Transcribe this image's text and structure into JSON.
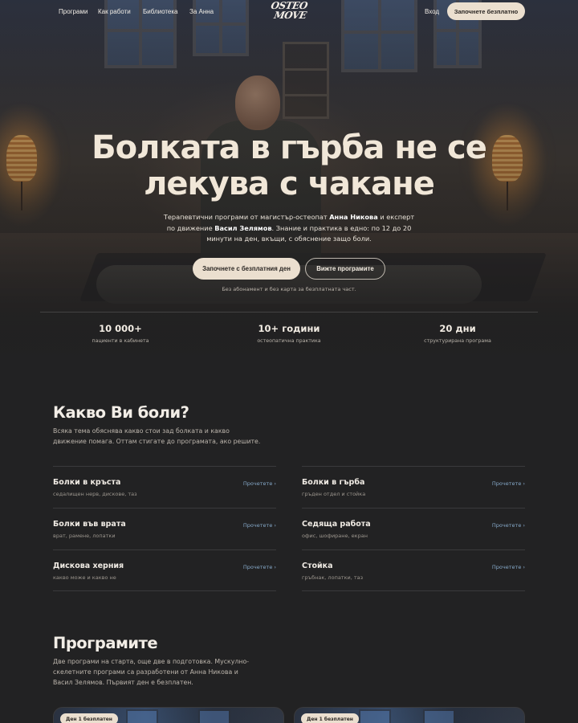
{
  "nav": {
    "links": [
      "Програми",
      "Как работи",
      "Библиотека",
      "За Анна"
    ],
    "logo_line1": "OSTEO",
    "logo_line2": "MOVE",
    "login": "Вход",
    "cta": "Започнете безплатно"
  },
  "hero": {
    "title": "Болката в гърба не се лекува с чакане",
    "subtitle_part1": "Терапевтични програми от магистър-остеопат ",
    "subtitle_name1": "Анна Никова",
    "subtitle_part2": " и експерт по движение ",
    "subtitle_name2": "Васил Зелямов",
    "subtitle_part3": ". Знание и практика в едно: по 12 до 20 минути на ден, вкъщи, с обяснение защо боли.",
    "primary_button": "Започнете с безплатния ден",
    "secondary_button": "Вижте програмите",
    "note": "Без абонамент и без карта за безплатната част."
  },
  "stats": [
    {
      "value": "10 000+",
      "label": "пациенти в кабинета"
    },
    {
      "value": "10+ години",
      "label": "остеопатична практика"
    },
    {
      "value": "20 дни",
      "label": "структурирана програма"
    }
  ],
  "pain": {
    "title": "Какво Ви боли?",
    "description": "Всяка тема обяснява какво стои зад болката и какво движение помага. Оттам стигате до програмата, ако решите.",
    "link_label": "Прочетете ›",
    "items": [
      {
        "name": "Болки в кръста",
        "sub": "седалищен нерв, дискове, таз"
      },
      {
        "name": "Болки в гърба",
        "sub": "гръден отдел и стойка"
      },
      {
        "name": "Болки във врата",
        "sub": "врат, рамене, лопатки"
      },
      {
        "name": "Седяща работа",
        "sub": "офис, шофиране, екран"
      },
      {
        "name": "Дискова херния",
        "sub": "какво може и какво не"
      },
      {
        "name": "Стойка",
        "sub": "гръбнак, лопатки, таз"
      }
    ]
  },
  "programs": {
    "title": "Програмите",
    "description": "Две програми на старта, още две в подготовка. Мускулно-скелетните програми са разработени от Анна Никова и Васил Зелямов. Първият ден е безплатен.",
    "cards": [
      {
        "badge": "Ден 1 безплатен"
      },
      {
        "badge": "Ден 1 безплатен"
      }
    ]
  }
}
